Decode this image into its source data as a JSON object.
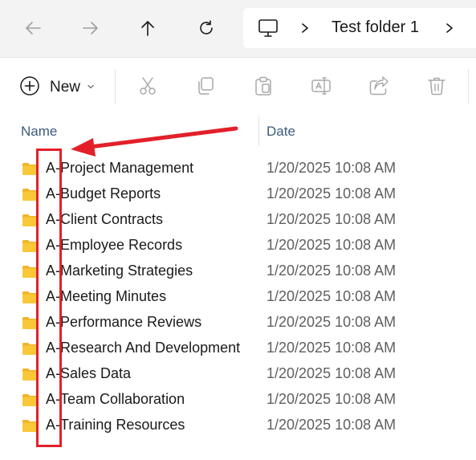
{
  "colors": {
    "nav_background": "#f3f3f3",
    "folder_yellow": "#f8c838",
    "annotation_red": "#e3202a",
    "header_text": "#3b5b7d"
  },
  "nav": {
    "back_icon": "arrow-left-icon",
    "forward_icon": "arrow-right-icon",
    "up_icon": "arrow-up-icon",
    "refresh_icon": "refresh-icon",
    "address": {
      "root_icon": "this-pc-icon",
      "crumb": "Test folder 1"
    }
  },
  "toolbar": {
    "new_label": "New",
    "icons": [
      "cut-icon",
      "copy-icon",
      "paste-icon",
      "rename-icon",
      "share-icon",
      "delete-icon"
    ]
  },
  "columns": {
    "name": "Name",
    "date": "Date"
  },
  "files": [
    {
      "name": "A-Project Management",
      "date": "1/20/2025 10:08 AM"
    },
    {
      "name": "A-Budget Reports",
      "date": "1/20/2025 10:08 AM"
    },
    {
      "name": "A-Client Contracts",
      "date": "1/20/2025 10:08 AM"
    },
    {
      "name": "A-Employee Records",
      "date": "1/20/2025 10:08 AM"
    },
    {
      "name": "A-Marketing Strategies",
      "date": "1/20/2025 10:08 AM"
    },
    {
      "name": "A-Meeting Minutes",
      "date": "1/20/2025 10:08 AM"
    },
    {
      "name": "A-Performance Reviews",
      "date": "1/20/2025 10:08 AM"
    },
    {
      "name": "A-Research And Development",
      "date": "1/20/2025 10:08 AM"
    },
    {
      "name": "A-Sales Data",
      "date": "1/20/2025 10:08 AM"
    },
    {
      "name": "A-Team Collaboration",
      "date": "1/20/2025 10:08 AM"
    },
    {
      "name": "A-Training Resources",
      "date": "1/20/2025 10:08 AM"
    }
  ]
}
